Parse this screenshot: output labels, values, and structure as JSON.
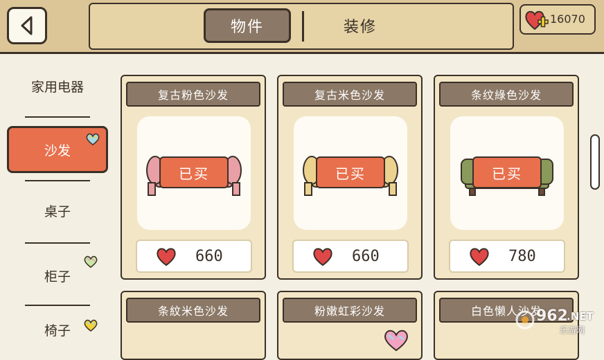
{
  "header": {
    "tabs": [
      {
        "label": "物件",
        "active": true
      },
      {
        "label": "装修",
        "active": false
      }
    ],
    "hearts": "16070"
  },
  "sidebar": {
    "items": [
      {
        "label": "家用电器"
      },
      {
        "label": "沙发",
        "active": true
      },
      {
        "label": "桌子"
      },
      {
        "label": "柜子"
      },
      {
        "label": "椅子"
      }
    ]
  },
  "items": [
    {
      "name": "复古粉色沙发",
      "status": "已买",
      "price": "660",
      "color": "#e8a0a6"
    },
    {
      "name": "复古米色沙发",
      "status": "已买",
      "price": "660",
      "color": "#ecd28f"
    },
    {
      "name": "条纹綠色沙发",
      "status": "已买",
      "price": "780",
      "color": "#8a9a5b"
    },
    {
      "name": "条紋米色沙发"
    },
    {
      "name": "粉嫩虹彩沙发"
    },
    {
      "name": "白色懒人沙发"
    }
  ],
  "watermark": {
    "brand": "962",
    "suffix": ".NET",
    "sub": "乐游网"
  },
  "colors": {
    "accent": "#e8704d",
    "wood": "#8b7866",
    "bg": "#f4efe3"
  }
}
